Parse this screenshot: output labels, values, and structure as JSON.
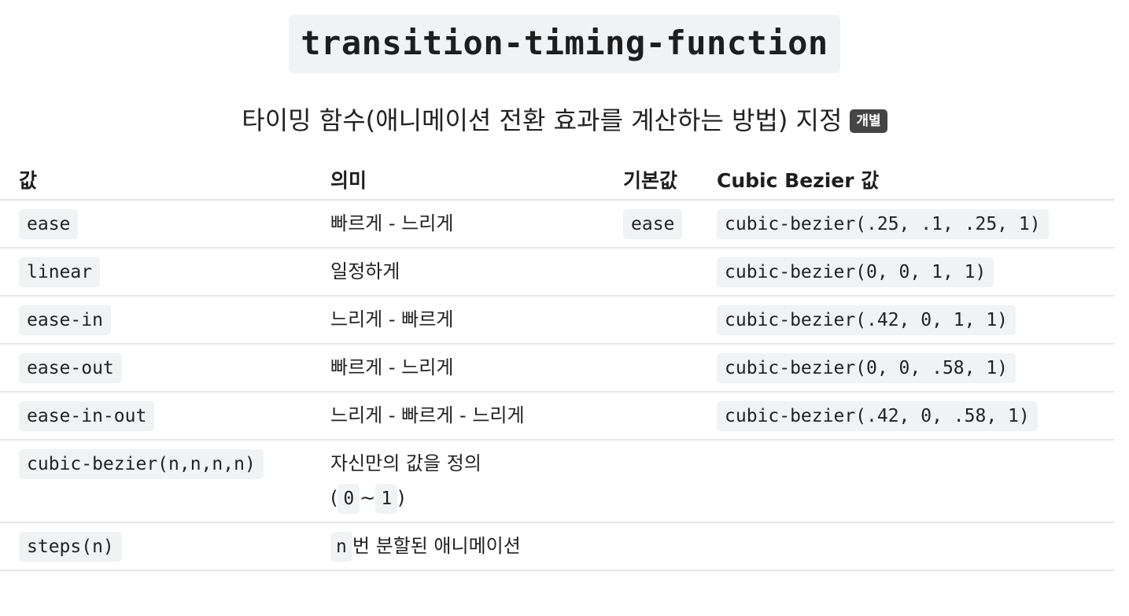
{
  "title": "transition-timing-function",
  "subtitle": "타이밍 함수(애니메이션 전환 효과를 계산하는 방법) 지정",
  "badge": "개별",
  "table": {
    "headers": [
      "값",
      "의미",
      "기본값",
      "Cubic Bezier 값"
    ],
    "rows": [
      {
        "value": "ease",
        "meaning": "빠르게 - 느리게",
        "default": "ease",
        "bezier": "cubic-bezier(.25, .1, .25, 1)"
      },
      {
        "value": "linear",
        "meaning": "일정하게",
        "default": "",
        "bezier": "cubic-bezier(0, 0, 1, 1)"
      },
      {
        "value": "ease-in",
        "meaning": "느리게 - 빠르게",
        "default": "",
        "bezier": "cubic-bezier(.42, 0, 1, 1)"
      },
      {
        "value": "ease-out",
        "meaning": "빠르게 - 느리게",
        "default": "",
        "bezier": "cubic-bezier(0, 0, .58, 1)"
      },
      {
        "value": "ease-in-out",
        "meaning": "느리게 - 빠르게 - 느리게",
        "default": "",
        "bezier": "cubic-bezier(.42, 0, .58, 1)"
      },
      {
        "value": "cubic-bezier(n,n,n,n)",
        "meaning": "자신만의 값을 정의",
        "meaning_range": {
          "open": "(",
          "from": "0",
          "sep": "~",
          "to": "1",
          "close": ")"
        },
        "default": "",
        "bezier": ""
      },
      {
        "value": "steps(n)",
        "meaning_code": "n",
        "meaning": "번 분할된 애니메이션",
        "default": "",
        "bezier": ""
      }
    ]
  }
}
